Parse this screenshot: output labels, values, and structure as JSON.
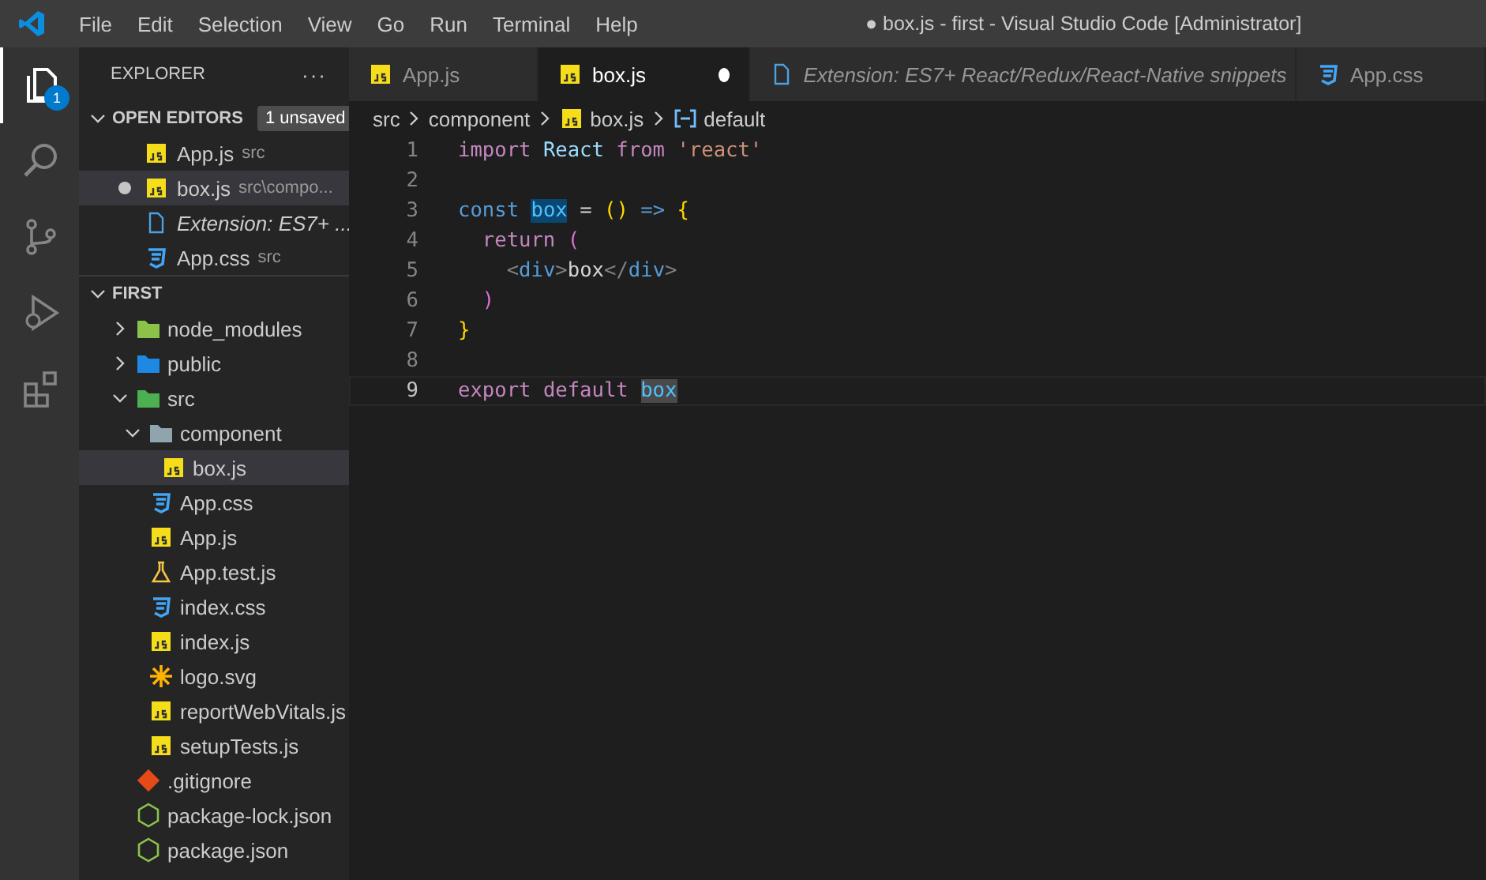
{
  "title_bar": {
    "menu": [
      "File",
      "Edit",
      "Selection",
      "View",
      "Go",
      "Run",
      "Terminal",
      "Help"
    ],
    "title": "● box.js - first - Visual Studio Code [Administrator]"
  },
  "activity_bar": [
    {
      "kind": "files",
      "selected": true,
      "badge": "1"
    },
    {
      "kind": "search",
      "selected": false
    },
    {
      "kind": "scm",
      "selected": false
    },
    {
      "kind": "debug",
      "selected": false
    },
    {
      "kind": "extensions",
      "selected": false
    }
  ],
  "sidebar": {
    "title": "EXPLORER",
    "more": "···",
    "open_editors": {
      "label": "OPEN EDITORS",
      "expanded": true,
      "badge": "1 unsaved",
      "items": [
        {
          "name": "App.js",
          "detail": "src",
          "kind": "js",
          "dirty": false,
          "selected": false,
          "preview": false
        },
        {
          "name": "box.js",
          "detail": "src\\compo...",
          "kind": "js",
          "dirty": true,
          "selected": true,
          "preview": false
        },
        {
          "name": "Extension: ES7+ ...",
          "kind": "file",
          "dirty": false,
          "selected": false,
          "preview": true
        },
        {
          "name": "App.css",
          "detail": "src",
          "kind": "css",
          "dirty": false,
          "selected": false,
          "preview": false
        }
      ]
    },
    "folder": {
      "label": "FIRST",
      "expanded": true,
      "items": [
        {
          "name": "node_modules",
          "kind": "nodefolder",
          "expanded": false,
          "selected": false
        },
        {
          "name": "public",
          "kind": "publicfolder",
          "expanded": false,
          "selected": false
        },
        {
          "name": "src",
          "kind": "srcfolder",
          "expanded": true,
          "selected": false,
          "children": [
            {
              "name": "component",
              "kind": "folder",
              "expanded": true,
              "selected": false,
              "children": [
                {
                  "name": "box.js",
                  "kind": "js",
                  "selected": true
                }
              ]
            },
            {
              "name": "App.css",
              "kind": "css",
              "selected": false
            },
            {
              "name": "App.js",
              "kind": "js",
              "selected": false
            },
            {
              "name": "App.test.js",
              "kind": "test",
              "selected": false
            },
            {
              "name": "index.css",
              "kind": "css",
              "selected": false
            },
            {
              "name": "index.js",
              "kind": "js",
              "selected": false
            },
            {
              "name": "logo.svg",
              "kind": "svg",
              "selected": false
            },
            {
              "name": "reportWebVitals.js",
              "kind": "js",
              "selected": false
            },
            {
              "name": "setupTests.js",
              "kind": "js",
              "selected": false
            }
          ]
        },
        {
          "name": ".gitignore",
          "kind": "git",
          "selected": false
        },
        {
          "name": "package-lock.json",
          "kind": "node",
          "selected": false
        },
        {
          "name": "package.json",
          "kind": "node",
          "selected": false
        }
      ]
    }
  },
  "tabs": [
    {
      "label": "App.js",
      "kind": "js",
      "selected": false,
      "dirty": false,
      "preview": false
    },
    {
      "label": "box.js",
      "kind": "js",
      "selected": true,
      "dirty": true,
      "preview": false
    },
    {
      "label": "Extension: ES7+ React/Redux/React-Native snippets",
      "kind": "file",
      "selected": false,
      "dirty": false,
      "preview": true
    },
    {
      "label": "App.css",
      "kind": "css",
      "selected": false,
      "dirty": false,
      "preview": false
    }
  ],
  "breadcrumbs": [
    {
      "label": "src",
      "kind": "none"
    },
    {
      "label": "component",
      "kind": "none"
    },
    {
      "label": "box.js",
      "kind": "js"
    },
    {
      "label": "default",
      "kind": "symbol"
    }
  ],
  "editor": {
    "lines": [
      {
        "number": "1",
        "current": false,
        "tokens": [
          {
            "text": "import ",
            "kind": "control"
          },
          {
            "text": "React ",
            "kind": "variable"
          },
          {
            "text": "from ",
            "kind": "control"
          },
          {
            "text": "'react'",
            "kind": "string"
          }
        ]
      },
      {
        "number": "2",
        "current": false
      },
      {
        "number": "3",
        "current": false,
        "tokens": [
          {
            "text": "const ",
            "kind": "keyword"
          },
          {
            "text": "box",
            "kind": "definition",
            "highlighted": true
          },
          {
            "text": " = ",
            "kind": "plain"
          },
          {
            "text": "()",
            "kind": "bracket1"
          },
          {
            "text": " => ",
            "kind": "keyword"
          },
          {
            "text": "{",
            "kind": "bracket1"
          }
        ]
      },
      {
        "number": "4",
        "current": false,
        "tokens": [
          {
            "text": "  return ",
            "kind": "control"
          },
          {
            "text": "(",
            "kind": "bracket2"
          }
        ]
      },
      {
        "number": "5",
        "current": false,
        "tokens": [
          {
            "text": "    <",
            "kind": "punct"
          },
          {
            "text": "div",
            "kind": "keyword"
          },
          {
            "text": ">",
            "kind": "punct"
          },
          {
            "text": "box",
            "kind": "plain"
          },
          {
            "text": "</",
            "kind": "punct"
          },
          {
            "text": "div",
            "kind": "keyword"
          },
          {
            "text": ">",
            "kind": "punct"
          }
        ]
      },
      {
        "number": "6",
        "current": false,
        "tokens": [
          {
            "text": "  )",
            "kind": "bracket2"
          }
        ]
      },
      {
        "number": "7",
        "current": false,
        "tokens": [
          {
            "text": "}",
            "kind": "bracket1"
          }
        ]
      },
      {
        "number": "8",
        "current": false
      },
      {
        "number": "9",
        "current": true,
        "tokens": [
          {
            "text": "export ",
            "kind": "control"
          },
          {
            "text": "default ",
            "kind": "control"
          },
          {
            "text": "box",
            "kind": "constant",
            "highlighted": true
          }
        ]
      }
    ]
  }
}
